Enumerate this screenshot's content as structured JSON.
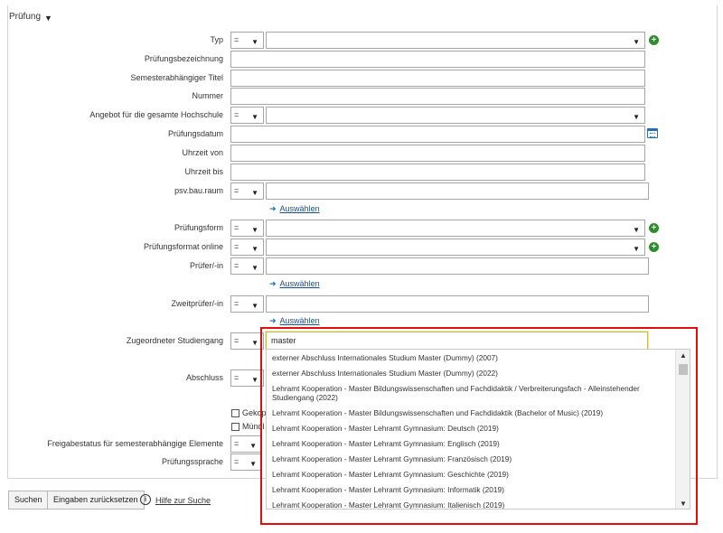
{
  "section": {
    "title": "Prüfung"
  },
  "fields": {
    "typ": {
      "label": "Typ",
      "op": "="
    },
    "pruefungsbezeichnung": {
      "label": "Prüfungsbezeichnung"
    },
    "semestertitel": {
      "label": "Semesterabhängiger Titel"
    },
    "nummer": {
      "label": "Nummer"
    },
    "angebot": {
      "label": "Angebot für die gesamte Hochschule",
      "op": "="
    },
    "datum": {
      "label": "Prüfungsdatum"
    },
    "uhrzeit_von": {
      "label": "Uhrzeit von"
    },
    "uhrzeit_bis": {
      "label": "Uhrzeit bis"
    },
    "raum": {
      "label": "psv.bau.raum",
      "op": "=",
      "link": "Auswählen"
    },
    "form": {
      "label": "Prüfungsform",
      "op": "="
    },
    "format_online": {
      "label": "Prüfungsformat online",
      "op": "="
    },
    "pruefer": {
      "label": "Prüfer/-in",
      "op": "=",
      "link": "Auswählen"
    },
    "zweitpruefer": {
      "label": "Zweitprüfer/-in",
      "op": "=",
      "link": "Auswählen"
    },
    "studiengang": {
      "label": "Zugeordneter Studiengang",
      "op": "=",
      "value": "master"
    },
    "abschluss": {
      "label": "Abschluss",
      "op": "="
    },
    "gekoppelt": {
      "label": "Gekop"
    },
    "muendlich": {
      "label": "Mündl"
    },
    "freigabe": {
      "label": "Freigabestatus für semesterabhängige Elemente",
      "op": "="
    },
    "sprache": {
      "label": "Prüfungssprache",
      "op": "="
    }
  },
  "suggestions": [
    "externer Abschluss Internationales Studium Master (Dummy) (2007)",
    "externer Abschluss Internationales Studium Master (Dummy) (2022)",
    "Lehramt Kooperation - Master Bildungswissenschaften und Fachdidaktik / Verbreiterungsfach - Alleinstehender Studiengang (2022)",
    "Lehramt Kooperation - Master Bildungswissenschaften und Fachdidaktik (Bachelor of Music) (2019)",
    "Lehramt Kooperation - Master Lehramt Gymnasium: Deutsch (2019)",
    "Lehramt Kooperation - Master Lehramt Gymnasium: Englisch (2019)",
    "Lehramt Kooperation - Master Lehramt Gymnasium: Französisch (2019)",
    "Lehramt Kooperation - Master Lehramt Gymnasium: Geschichte (2019)",
    "Lehramt Kooperation - Master Lehramt Gymnasium: Informatik (2019)",
    "Lehramt Kooperation - Master Lehramt Gymnasium: Italienisch (2019)"
  ],
  "buttons": {
    "search": "Suchen",
    "reset": "Eingaben zurücksetzen",
    "help": "Hilfe zur Suche"
  },
  "colors": {
    "highlight": "#e20d0d",
    "plus": "#2e8b2e",
    "link": "#1c4e8c"
  }
}
